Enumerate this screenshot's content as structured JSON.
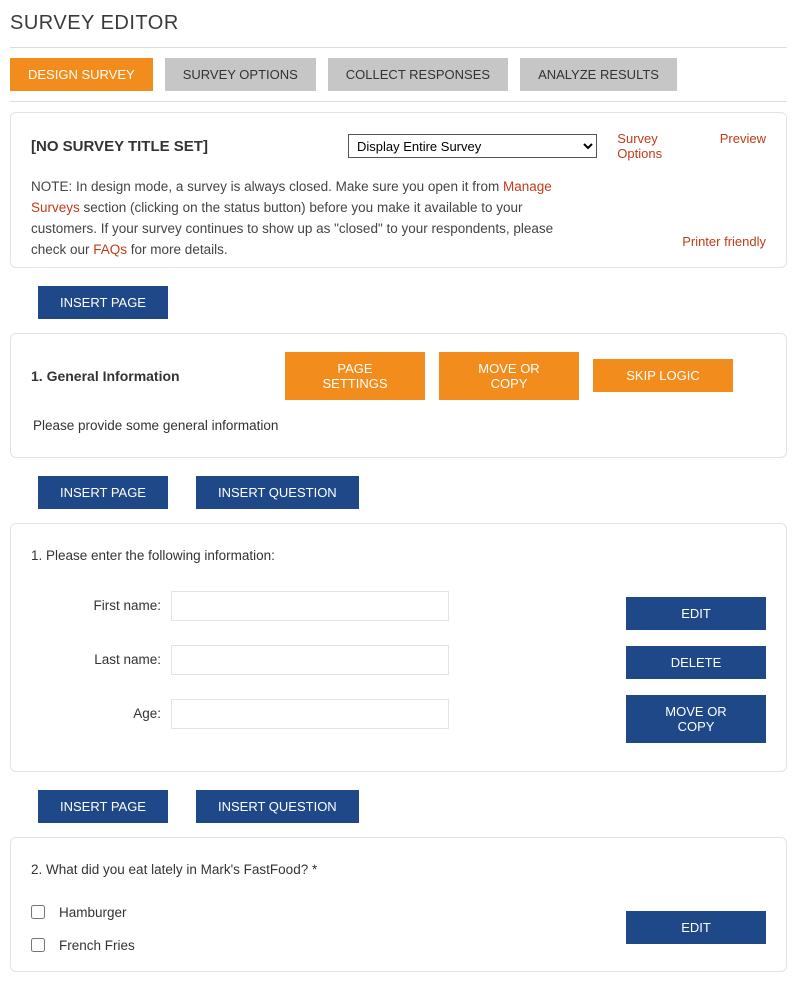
{
  "page_title": "SURVEY EDITOR",
  "tabs": {
    "design": "DESIGN SURVEY",
    "options": "SURVEY OPTIONS",
    "collect": "COLLECT RESPONSES",
    "analyze": "ANALYZE RESULTS"
  },
  "info": {
    "survey_title": "[NO SURVEY TITLE SET]",
    "display_selected": "Display Entire Survey",
    "links": {
      "survey_options": "Survey Options",
      "preview": "Preview",
      "printer": "Printer friendly"
    },
    "note_prefix": "NOTE: In design mode, a survey is always closed. Make sure you open it from ",
    "note_link1": "Manage Surveys",
    "note_mid": " section (clicking on the status button) before you make it available to your customers. If your survey continues to show up as \"closed\" to your respondents, please check our ",
    "note_link2": "FAQs",
    "note_suffix": " for more details."
  },
  "buttons": {
    "insert_page": "INSERT PAGE",
    "insert_question": "INSERT QUESTION",
    "page_settings": "PAGE SETTINGS",
    "move_or_copy": "MOVE OR COPY",
    "skip_logic": "SKIP LOGIC",
    "edit": "EDIT",
    "delete": "DELETE"
  },
  "page1": {
    "heading": "1. General Information",
    "description": "Please provide some general information"
  },
  "q1": {
    "text": "1. Please enter the following information:",
    "fields": {
      "first_name": "First name:",
      "last_name": "Last name:",
      "age": "Age:"
    }
  },
  "q2": {
    "text": "2. What did you eat lately in Mark's FastFood? *",
    "options": {
      "opt1": "Hamburger",
      "opt2": "French Fries"
    }
  }
}
